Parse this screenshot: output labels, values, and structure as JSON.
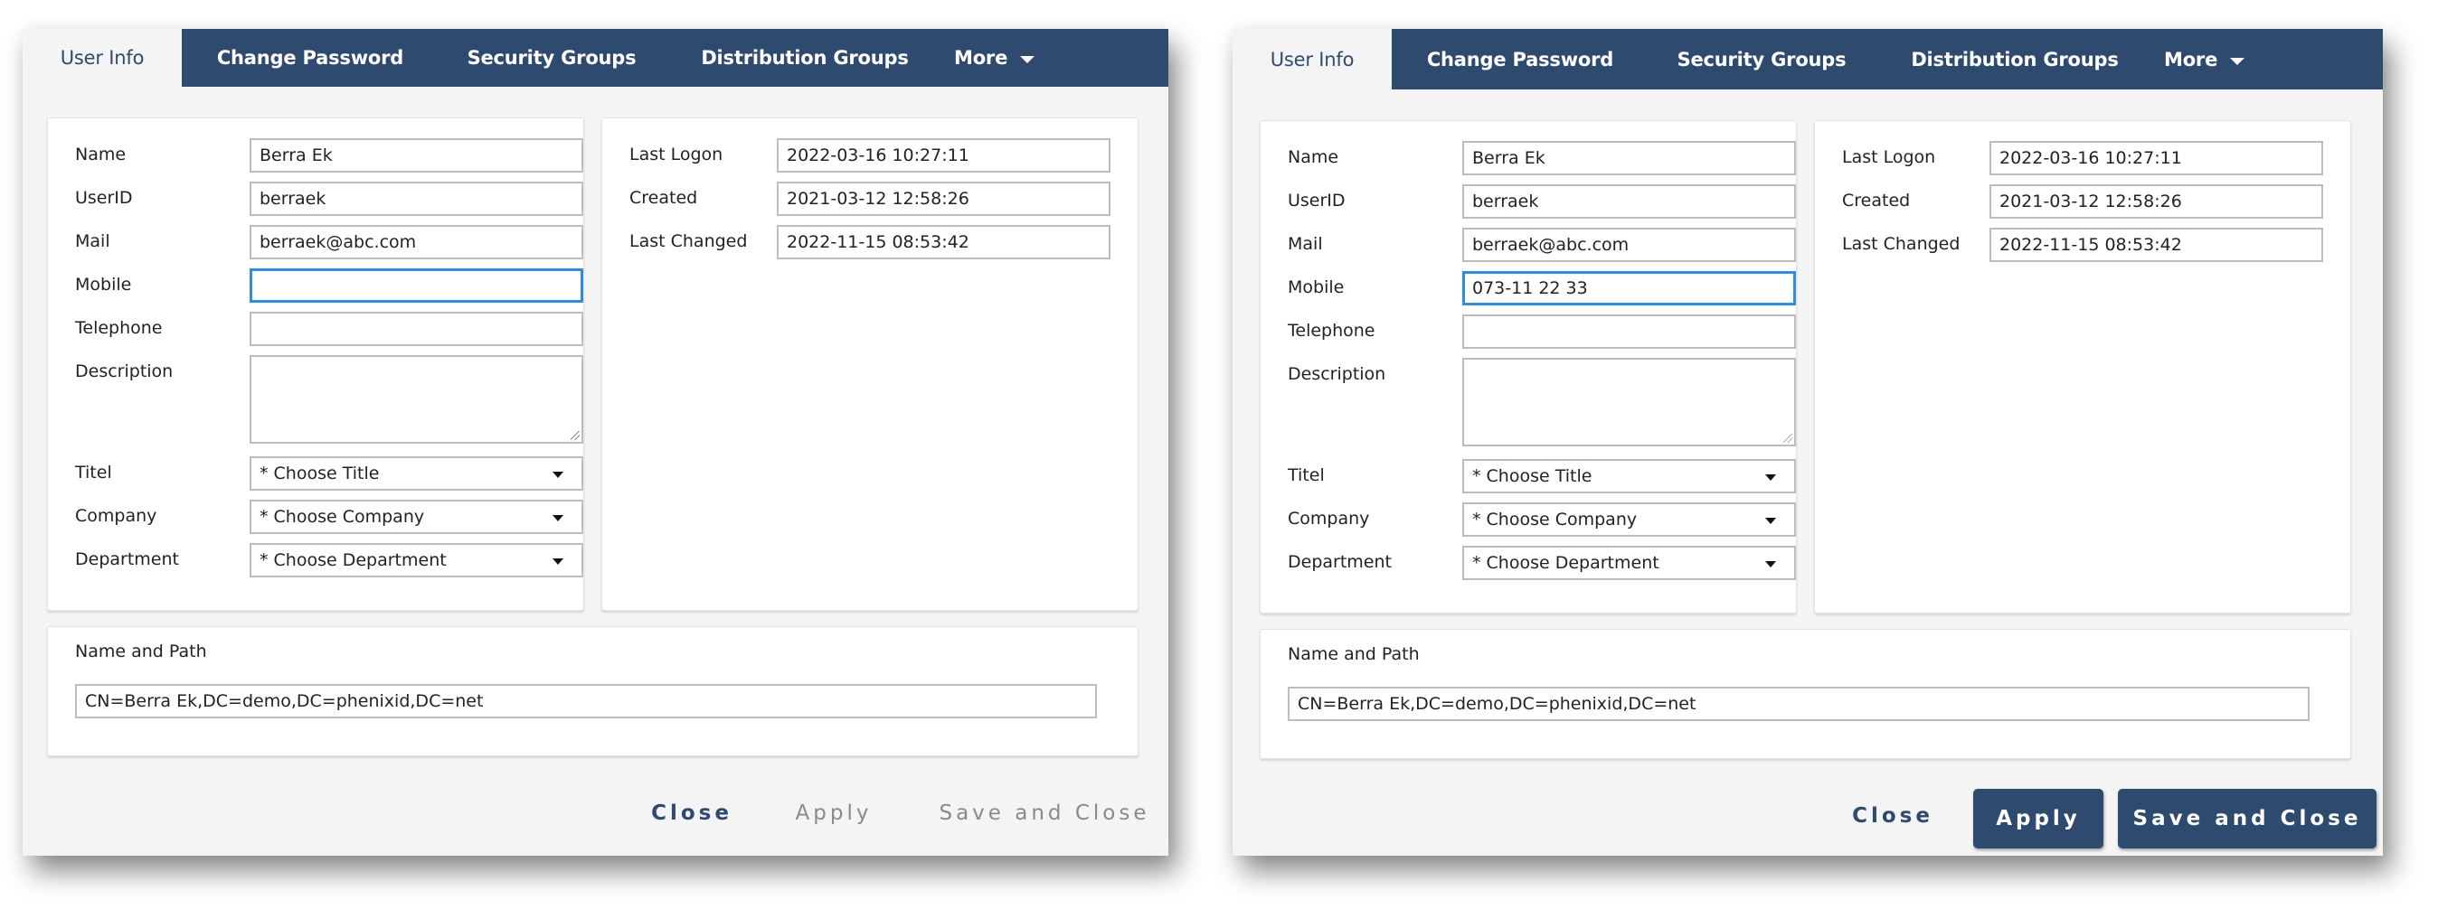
{
  "dialogs": [
    {
      "id": "dlg-left",
      "tabs": [
        {
          "label": "User Info",
          "active": true
        },
        {
          "label": "Change Password",
          "active": false
        },
        {
          "label": "Security Groups",
          "active": false
        },
        {
          "label": "Distribution Groups",
          "active": false
        },
        {
          "label": "More",
          "active": false,
          "has_dropdown": true
        }
      ],
      "user_fields": [
        {
          "label": "Name",
          "value": "Berra Ek",
          "type": "text"
        },
        {
          "label": "UserID",
          "value": "berraek",
          "type": "text"
        },
        {
          "label": "Mail",
          "value": "berraek@abc.com",
          "type": "text"
        },
        {
          "label": "Mobile",
          "value": "",
          "type": "text",
          "focused": true
        },
        {
          "label": "Telephone",
          "value": "",
          "type": "text"
        },
        {
          "label": "Description",
          "value": "",
          "type": "textarea"
        },
        {
          "label": "Titel",
          "value": "* Choose Title",
          "type": "select"
        },
        {
          "label": "Company",
          "value": "* Choose Company",
          "type": "select"
        },
        {
          "label": "Department",
          "value": "* Choose Department",
          "type": "select"
        }
      ],
      "info_fields": [
        {
          "label": "Last Logon",
          "value": "2022-03-16 10:27:11"
        },
        {
          "label": "Created",
          "value": "2021-03-12 12:58:26"
        },
        {
          "label": "Last Changed",
          "value": "2022-11-15 08:53:42"
        }
      ],
      "path": {
        "title": "Name and Path",
        "value": "CN=Berra Ek,DC=demo,DC=phenixid,DC=net"
      },
      "buttons": {
        "close": {
          "label": "Close",
          "enabled": true
        },
        "apply": {
          "label": "Apply",
          "enabled": false
        },
        "save_and_close": {
          "label": "Save and Close",
          "enabled": false
        }
      }
    },
    {
      "id": "dlg-right",
      "tabs": [
        {
          "label": "User Info",
          "active": true
        },
        {
          "label": "Change Password",
          "active": false
        },
        {
          "label": "Security Groups",
          "active": false
        },
        {
          "label": "Distribution Groups",
          "active": false
        },
        {
          "label": "More",
          "active": false,
          "has_dropdown": true
        }
      ],
      "user_fields": [
        {
          "label": "Name",
          "value": "Berra Ek",
          "type": "text"
        },
        {
          "label": "UserID",
          "value": "berraek",
          "type": "text"
        },
        {
          "label": "Mail",
          "value": "berraek@abc.com",
          "type": "text"
        },
        {
          "label": "Mobile",
          "value": "073-11 22 33",
          "type": "text",
          "focused": true
        },
        {
          "label": "Telephone",
          "value": "",
          "type": "text"
        },
        {
          "label": "Description",
          "value": "",
          "type": "textarea"
        },
        {
          "label": "Titel",
          "value": "* Choose Title",
          "type": "select"
        },
        {
          "label": "Company",
          "value": "* Choose Company",
          "type": "select"
        },
        {
          "label": "Department",
          "value": "* Choose Department",
          "type": "select"
        }
      ],
      "info_fields": [
        {
          "label": "Last Logon",
          "value": "2022-03-16 10:27:11"
        },
        {
          "label": "Created",
          "value": "2021-03-12 12:58:26"
        },
        {
          "label": "Last Changed",
          "value": "2022-11-15 08:53:42"
        }
      ],
      "path": {
        "title": "Name and Path",
        "value": "CN=Berra Ek,DC=demo,DC=phenixid,DC=net"
      },
      "buttons": {
        "close": {
          "label": "Close",
          "enabled": true
        },
        "apply": {
          "label": "Apply",
          "enabled": true
        },
        "save_and_close": {
          "label": "Save and Close",
          "enabled": true
        }
      }
    }
  ],
  "icons": {
    "tab_more_dropdown": "caret-down-icon",
    "select_dropdown": "caret-down-icon",
    "textarea_resize": "resize-handle-icon"
  },
  "colors": {
    "accent": "#2f4a6f",
    "focus_border": "#2f8ddc",
    "disabled_text": "#8a8a8a",
    "dialog_bg": "#f4f4f4"
  }
}
